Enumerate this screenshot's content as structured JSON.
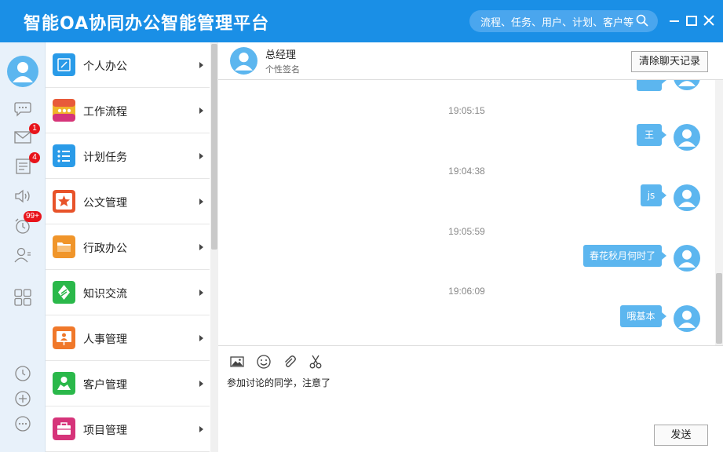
{
  "app": {
    "title": "智能OA协同办公智能管理平台",
    "search_placeholder": "流程、任务、用户、计划、客户等"
  },
  "rail": {
    "badges": {
      "mail": "1",
      "news": "4",
      "reminders": "99+"
    }
  },
  "menu": {
    "items": [
      {
        "label": "个人办公",
        "icon": "edit-icon",
        "color": "#2a9be8"
      },
      {
        "label": "工作流程",
        "icon": "workflow-icon",
        "color": "#e8a32a"
      },
      {
        "label": "计划任务",
        "icon": "list-icon",
        "color": "#2a9be8"
      },
      {
        "label": "公文管理",
        "icon": "star-icon",
        "color": "#e8532a"
      },
      {
        "label": "行政办公",
        "icon": "folder-icon",
        "color": "#f0952a"
      },
      {
        "label": "知识交流",
        "icon": "knowledge-icon",
        "color": "#2ab84a"
      },
      {
        "label": "人事管理",
        "icon": "hr-icon",
        "color": "#f0782a"
      },
      {
        "label": "客户管理",
        "icon": "customer-icon",
        "color": "#2ab84a"
      },
      {
        "label": "项目管理",
        "icon": "briefcase-icon",
        "color": "#d6347a"
      }
    ]
  },
  "chat": {
    "name": "总经理",
    "signature": "个性签名",
    "clear_label": "清除聊天记录",
    "messages": [
      {
        "time": "19:05:15",
        "text": "王"
      },
      {
        "time": "19:04:38",
        "text": "js"
      },
      {
        "time": "19:05:59",
        "text": "春花秋月何时了"
      },
      {
        "time": "19:06:09",
        "text": "哦基本"
      }
    ]
  },
  "composer": {
    "text": "参加讨论的同学，注意了",
    "send_label": "发送"
  }
}
